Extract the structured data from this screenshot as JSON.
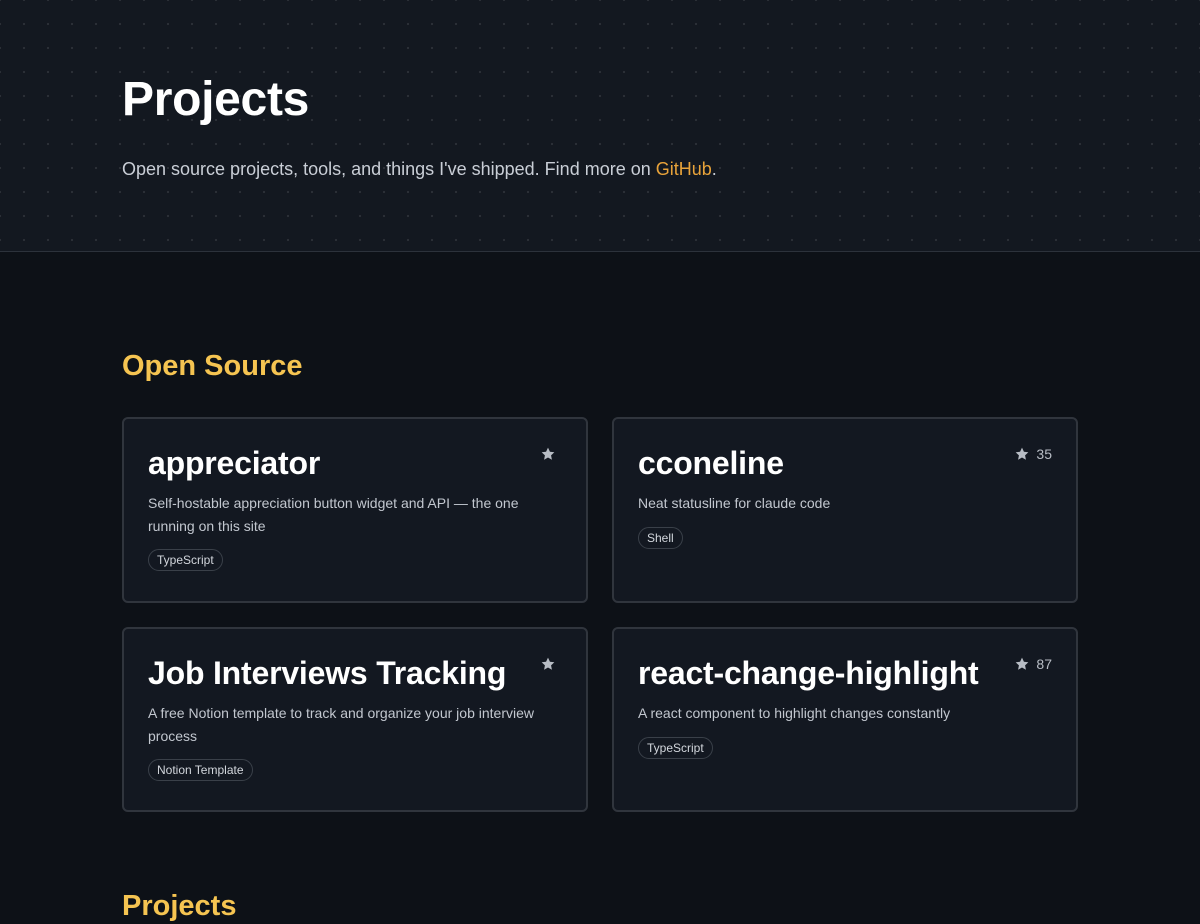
{
  "header": {
    "title": "Projects",
    "subtitle_prefix": "Open source projects, tools, and things I've shipped. Find more on ",
    "subtitle_link": "GitHub",
    "subtitle_suffix": "."
  },
  "sections": [
    {
      "title": "Open Source"
    },
    {
      "title": "Projects"
    }
  ],
  "projects": [
    {
      "name": "appreciator",
      "description": "Self-hostable appreciation button widget and API — the one running on this site",
      "tag": "TypeScript",
      "stars": ""
    },
    {
      "name": "cconeline",
      "description": "Neat statusline for claude code",
      "tag": "Shell",
      "stars": "35"
    },
    {
      "name": "Job Interviews Tracking",
      "description": "A free Notion template to track and organize your job interview process",
      "tag": "Notion Template",
      "stars": ""
    },
    {
      "name": "react-change-highlight",
      "description": "A react component to highlight changes constantly",
      "tag": "TypeScript",
      "stars": "87"
    }
  ],
  "icons": {
    "star": "star-icon"
  },
  "colors": {
    "accent": "#f5c451",
    "link": "#e8a33a",
    "background": "#0d1117",
    "card_background": "#131821",
    "card_border": "#30353d"
  }
}
